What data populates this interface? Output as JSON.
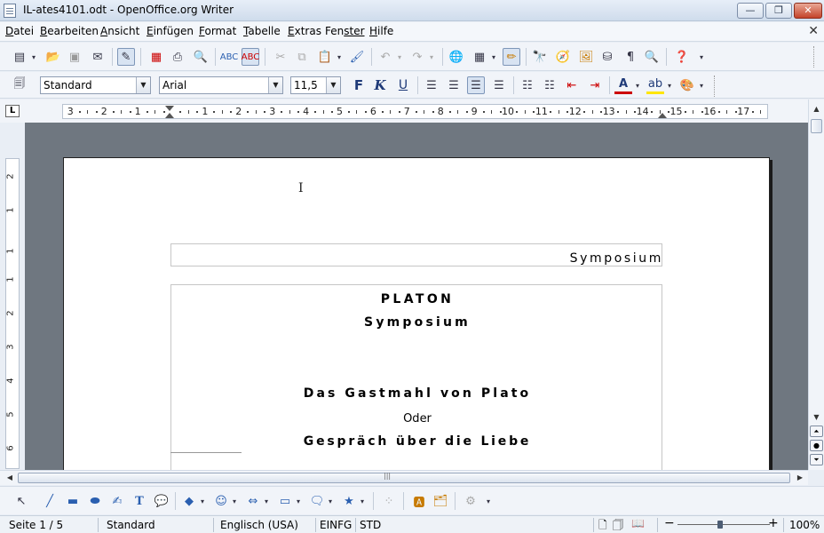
{
  "window": {
    "title": "IL-ates4101.odt - OpenOffice.org Writer",
    "min_glyph": "—",
    "max_glyph": "❐",
    "close_glyph": "✕"
  },
  "menu": {
    "items": [
      {
        "underline": "D",
        "rest": "atei"
      },
      {
        "underline": "B",
        "rest": "earbeiten"
      },
      {
        "underline": "A",
        "rest": "nsicht"
      },
      {
        "underline": "E",
        "rest": "infügen"
      },
      {
        "underline": "F",
        "rest": "ormat"
      },
      {
        "underline": "T",
        "rest": "abelle"
      },
      {
        "underline": "E",
        "rest": "xtras"
      },
      {
        "underline": "Fen",
        "rest": "ster",
        "split": true
      },
      {
        "underline": "H",
        "rest": "ilfe"
      }
    ],
    "doc_close": "✕"
  },
  "toolbar_format": {
    "style": "Standard",
    "font": "Arial",
    "size": "11,5",
    "bold": "F",
    "italic": "K",
    "underline": "U"
  },
  "ruler": {
    "numbers": [
      "3",
      "2",
      "1",
      "1",
      "2",
      "3",
      "4",
      "5",
      "6",
      "7",
      "8",
      "9",
      "10",
      "11",
      "12",
      "13",
      "14",
      "15",
      "16",
      "17"
    ],
    "corner": "L",
    "vertical_numbers": [
      "2",
      "1",
      "1",
      "1",
      "2",
      "3",
      "4",
      "5",
      "6"
    ]
  },
  "document": {
    "header": "Symposium",
    "line1": "PLATON",
    "line2": "Symposium",
    "line3": "Das Gastmahl von Plato",
    "line4": "Oder",
    "line5": "Gespräch über die Liebe",
    "cursor": "I"
  },
  "statusbar": {
    "page": "Seite 1 / 5",
    "style": "Standard",
    "language": "Englisch (USA)",
    "insert_mode": "EINFG",
    "selection_mode": "STD",
    "zoom": "100%",
    "zoom_minus": "−",
    "zoom_plus": "+"
  }
}
